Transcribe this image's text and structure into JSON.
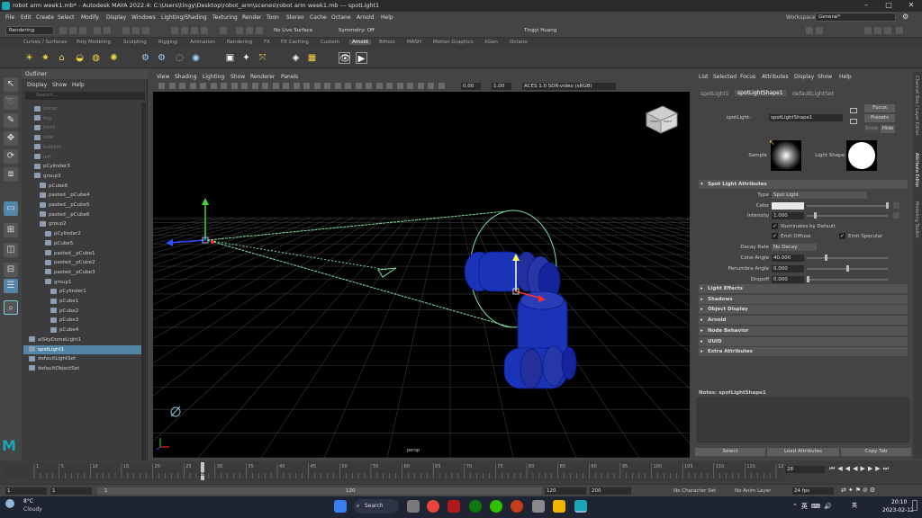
{
  "titlebar": {
    "title": "robot arm week1.mb* - Autodesk MAYA 2022.4: C:\\Users\\tingy\\Desktop\\robot_arm\\scenes\\robot arm week1.mb  ---  spotLight1",
    "min": "–",
    "max": "□",
    "close": "✕"
  },
  "menu": [
    "File",
    "Edit",
    "Create",
    "Select",
    "Modify",
    "Display",
    "Windows",
    "Lighting/Shading",
    "Texturing",
    "Render",
    "Toon",
    "Stereo",
    "Cache",
    "Octane",
    "Arnold",
    "Help"
  ],
  "workspace": {
    "label": "Workspace :",
    "value": "General*"
  },
  "statusline": {
    "menuset": "Rendering",
    "live": "No Live Surface",
    "symmetry": "Symmetry: Off",
    "user": "Tingyi Huang"
  },
  "shelf_tabs": [
    "Curves / Surfaces",
    "Poly Modeling",
    "Sculpting",
    "Rigging",
    "Animation",
    "Rendering",
    "FX",
    "FX Caching",
    "Custom",
    "Arnold",
    "Bifrost",
    "MASH",
    "Motion Graphics",
    "XGen",
    "Octane"
  ],
  "shelf_active": "Arnold",
  "outliner": {
    "title": "Outliner",
    "menu": [
      "Display",
      "Show",
      "Help"
    ],
    "search": "Search...",
    "items": [
      {
        "label": "persp",
        "indent": 1,
        "dim": true
      },
      {
        "label": "top",
        "indent": 1,
        "dim": true
      },
      {
        "label": "front",
        "indent": 1,
        "dim": true
      },
      {
        "label": "side",
        "indent": 1,
        "dim": true
      },
      {
        "label": "bottom",
        "indent": 1,
        "dim": true
      },
      {
        "label": "left",
        "indent": 1,
        "dim": true
      },
      {
        "label": "pCylinder3",
        "indent": 1
      },
      {
        "label": "group3",
        "indent": 1
      },
      {
        "label": "pCube6",
        "indent": 2
      },
      {
        "label": "pasted__pCube4",
        "indent": 2
      },
      {
        "label": "pasted__pCube5",
        "indent": 2
      },
      {
        "label": "pasted__pCube6",
        "indent": 2
      },
      {
        "label": "group2",
        "indent": 2
      },
      {
        "label": "pCylinder2",
        "indent": 3
      },
      {
        "label": "pCube5",
        "indent": 3
      },
      {
        "label": "pasted__pCube1",
        "indent": 3
      },
      {
        "label": "pasted__pCube2",
        "indent": 3
      },
      {
        "label": "pasted__pCube3",
        "indent": 3
      },
      {
        "label": "group1",
        "indent": 3
      },
      {
        "label": "pCylinder1",
        "indent": 4
      },
      {
        "label": "pCube1",
        "indent": 4
      },
      {
        "label": "pCube2",
        "indent": 4
      },
      {
        "label": "pCube3",
        "indent": 4
      },
      {
        "label": "pCube4",
        "indent": 4
      },
      {
        "label": "aiSkyDomeLight1",
        "indent": 0
      },
      {
        "label": "spotLight1",
        "indent": 0,
        "selected": true
      },
      {
        "label": "defaultLightSet",
        "indent": 0
      },
      {
        "label": "defaultObjectSet",
        "indent": 0
      }
    ]
  },
  "viewport": {
    "menu": [
      "View",
      "Shading",
      "Lighting",
      "Show",
      "Renderer",
      "Panels"
    ],
    "val1": "0.00",
    "val2": "1.00",
    "colorspace": "ACES 1.0 SDR-video (sRGB)",
    "camera": "persp",
    "cube_front": "FRONT",
    "cube_right": "RIGHT"
  },
  "ae": {
    "menu": [
      "List",
      "Selected",
      "Focus",
      "Attributes",
      "Display",
      "Show",
      "Help"
    ],
    "tabs": [
      "spotLight1",
      "spotLightShape1",
      "defaultLightSet"
    ],
    "node_label": "spotLight:",
    "node_value": "spotLightShape1",
    "focus": "Focus",
    "presets": "Presets",
    "show": "Show",
    "hide": "Hide",
    "sample": "Sample",
    "light_shape": "Light Shape",
    "section": "Spot Light Attributes",
    "type_label": "Type",
    "type_value": "Spot Light",
    "color_label": "Color",
    "intensity_label": "Intensity",
    "intensity": "1.000",
    "illum": "Illuminates by Default",
    "diffuse": "Emit Diffuse",
    "specular": "Emit Specular",
    "decay_label": "Decay Rate",
    "decay": "No Decay",
    "cone_label": "Cone Angle",
    "cone": "40.000",
    "penumbra_label": "Penumbra Angle",
    "penumbra": "0.000",
    "dropoff_label": "Dropoff",
    "dropoff": "0.000",
    "sections": [
      "Light Effects",
      "Shadows",
      "Object Display",
      "Arnold",
      "Node Behavior",
      "UUID",
      "Extra Attributes"
    ],
    "notes": "Notes: spotLightShape1",
    "select": "Select",
    "load": "Load Attributes",
    "copy": "Copy Tab"
  },
  "rightdock": [
    "Channel Box / Layer Editor",
    "Attribute Editor",
    "Modeling Toolkit"
  ],
  "timeline": {
    "ticks": [
      "1",
      "5",
      "10",
      "15",
      "20",
      "25",
      "30",
      "35",
      "40",
      "45",
      "50",
      "55",
      "60",
      "65",
      "70",
      "75",
      "80",
      "85",
      "90",
      "95",
      "100",
      "105",
      "110",
      "115",
      "120"
    ],
    "current": "28",
    "field": "28"
  },
  "range": {
    "start": "1",
    "s2": "1",
    "s3": "1",
    "end1": "120",
    "end2": "120",
    "end3": "200",
    "char": "No Character Set",
    "anim": "No Anim Layer",
    "fps": "24 fps"
  },
  "taskbar": {
    "temp": "8°C",
    "weather": "Cloudy",
    "search": "Search",
    "lang": "英",
    "time": "20:10",
    "date": "2023-02-12"
  },
  "colors": {
    "selection": "#5285a6",
    "viewport": "#000000",
    "light": "#7fe0a0"
  }
}
